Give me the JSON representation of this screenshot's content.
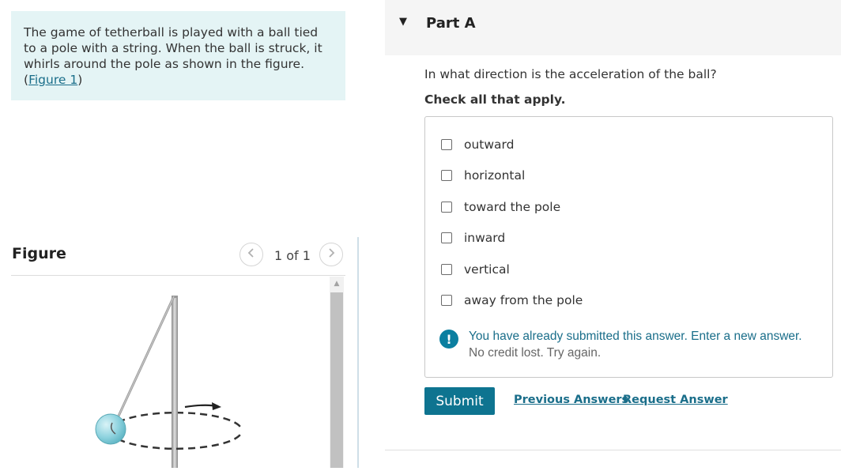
{
  "intro": {
    "text": "The game of tetherball is played with a ball tied to a pole with a string. When the ball is struck, it whirls around the pole as shown in the figure.",
    "link_open": "(",
    "link_text": "Figure 1",
    "link_close": ")"
  },
  "figure": {
    "title": "Figure",
    "page_indicator": "1 of 1",
    "prev_icon": "chevron-left",
    "next_icon": "chevron-right"
  },
  "part": {
    "title": "Part A",
    "caret_icon": "caret-down"
  },
  "question": {
    "text": "In what direction is the acceleration of the ball?",
    "instruction": "Check all that apply.",
    "options": [
      {
        "label": "outward",
        "checked": false
      },
      {
        "label": "horizontal",
        "checked": false
      },
      {
        "label": "toward the pole",
        "checked": false
      },
      {
        "label": "inward",
        "checked": false
      },
      {
        "label": "vertical",
        "checked": false
      },
      {
        "label": "away from the pole",
        "checked": false
      }
    ]
  },
  "feedback": {
    "icon": "exclamation-circle",
    "message": "You have already submitted this answer. Enter a new answer.",
    "submessage": "No credit lost. Try again."
  },
  "actions": {
    "submit_label": "Submit",
    "previous_answers_label": "Previous Answers",
    "request_answer_label": "Request Answer"
  },
  "colors": {
    "accent": "#0e7490",
    "intro_bg": "#e4f4f5",
    "link": "#1a6e8a"
  }
}
